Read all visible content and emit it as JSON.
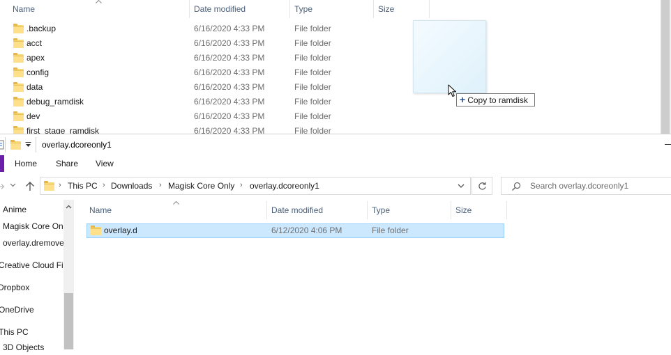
{
  "back_window": {
    "columns": {
      "name": "Name",
      "date": "Date modified",
      "type": "Type",
      "size": "Size"
    },
    "rows": [
      {
        "name": ".backup",
        "date": "6/16/2020 4:33 PM",
        "type": "File folder"
      },
      {
        "name": "acct",
        "date": "6/16/2020 4:33 PM",
        "type": "File folder"
      },
      {
        "name": "apex",
        "date": "6/16/2020 4:33 PM",
        "type": "File folder"
      },
      {
        "name": "config",
        "date": "6/16/2020 4:33 PM",
        "type": "File folder"
      },
      {
        "name": "data",
        "date": "6/16/2020 4:33 PM",
        "type": "File folder"
      },
      {
        "name": "debug_ramdisk",
        "date": "6/16/2020 4:33 PM",
        "type": "File folder"
      },
      {
        "name": "dev",
        "date": "6/16/2020 4:33 PM",
        "type": "File folder"
      },
      {
        "name": "first_stage_ramdisk",
        "date": "6/16/2020 4:33 PM",
        "type": "File folder"
      }
    ],
    "drag_tooltip": "Copy to ramdisk",
    "drag_plus": "+"
  },
  "front_window": {
    "title": "overlay.dcoreonly1",
    "tabs": {
      "home": "Home",
      "share": "Share",
      "view": "View"
    },
    "breadcrumb": [
      "This PC",
      "Downloads",
      "Magisk Core Only",
      "overlay.dcoreonly1"
    ],
    "search_placeholder": "Search overlay.dcoreonly1",
    "nav_items": [
      "Anime",
      "Magisk Core On",
      "overlay.dremove",
      "Creative Cloud Fil",
      "Dropbox",
      "OneDrive",
      "This PC",
      "3D Objects"
    ],
    "columns": {
      "name": "Name",
      "date": "Date modified",
      "type": "Type",
      "size": "Size"
    },
    "selected_item": {
      "name": "overlay.d",
      "date": "6/12/2020 4:06 PM",
      "type": "File folder"
    }
  },
  "colors": {
    "selection_bg": "#cce8ff",
    "selection_border": "#99d1ff",
    "file_tab": "#6b1fa8",
    "folder": "#ffe08a"
  }
}
